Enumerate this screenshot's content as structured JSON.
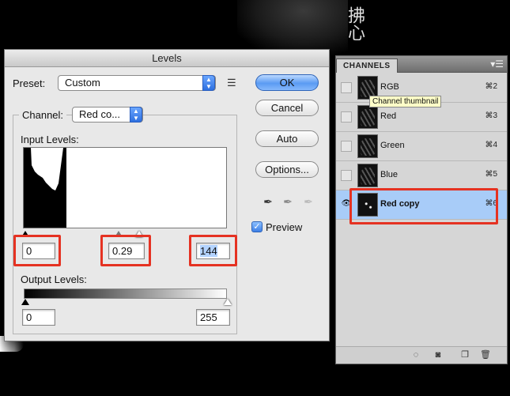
{
  "background": {
    "photo_text": "拂心"
  },
  "levels": {
    "title": "Levels",
    "preset_label": "Preset:",
    "preset_value": "Custom",
    "channel_label": "Channel:",
    "channel_value": "Red co...",
    "input_levels_label": "Input Levels:",
    "input_black": "0",
    "input_gamma": "0.29",
    "input_white": "144",
    "output_levels_label": "Output Levels:",
    "output_black": "0",
    "output_white": "255",
    "buttons": {
      "ok": "OK",
      "cancel": "Cancel",
      "auto": "Auto",
      "options": "Options..."
    },
    "preview_label": "Preview",
    "preview_checked": true
  },
  "channels": {
    "tab": "CHANNELS",
    "tooltip": "Channel thumbnail",
    "rows": [
      {
        "name": "RGB",
        "shortcut": "⌘2",
        "visible": false,
        "selected": false
      },
      {
        "name": "Red",
        "shortcut": "⌘3",
        "visible": false,
        "selected": false
      },
      {
        "name": "Green",
        "shortcut": "⌘4",
        "visible": false,
        "selected": false
      },
      {
        "name": "Blue",
        "shortcut": "⌘5",
        "visible": false,
        "selected": false
      },
      {
        "name": "Red copy",
        "shortcut": "⌘6",
        "visible": true,
        "selected": true
      }
    ]
  },
  "colors": {
    "highlight": "#e53222",
    "selection": "#a8ccf8",
    "accent": "#5a9bf3"
  }
}
